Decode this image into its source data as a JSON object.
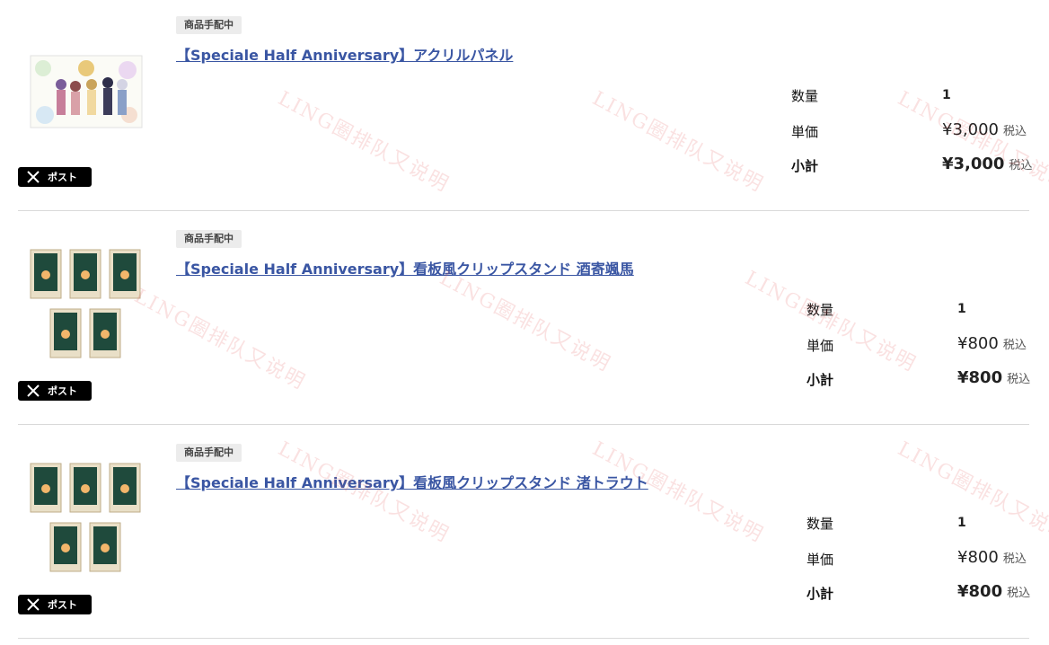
{
  "post_button_label": "ポスト",
  "watermark_text": "LING圈排队又说明",
  "items": [
    {
      "status": "商品手配中",
      "title": "【Speciale Half Anniversary】アクリルパネル",
      "quantity_label": "数量",
      "quantity": "1",
      "unit_price_label": "単価",
      "unit_price": "¥3,000",
      "subtotal_label": "小計",
      "subtotal": "¥3,000",
      "tax_label": "税込"
    },
    {
      "status": "商品手配中",
      "title": "【Speciale Half Anniversary】看板風クリップスタンド 酒寄颯馬",
      "quantity_label": "数量",
      "quantity": "1",
      "unit_price_label": "単価",
      "unit_price": "¥800",
      "subtotal_label": "小計",
      "subtotal": "¥800",
      "tax_label": "税込"
    },
    {
      "status": "商品手配中",
      "title": "【Speciale Half Anniversary】看板風クリップスタンド 渚トラウト",
      "quantity_label": "数量",
      "quantity": "1",
      "unit_price_label": "単価",
      "unit_price": "¥800",
      "subtotal_label": "小計",
      "subtotal": "¥800",
      "tax_label": "税込"
    }
  ],
  "colors": {
    "link": "#3a56a3",
    "badge_bg": "#ececec",
    "post_bg": "#000000"
  }
}
